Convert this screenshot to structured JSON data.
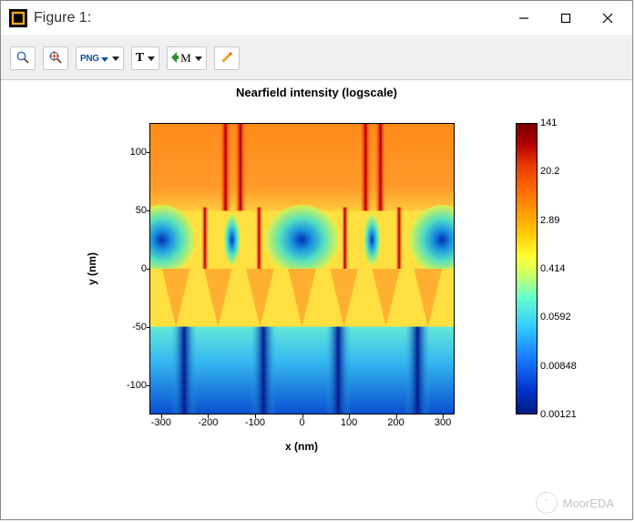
{
  "window": {
    "title": "Figure 1:"
  },
  "toolbar": {
    "png_label": "PNG",
    "t_label": "T",
    "m_label": "M"
  },
  "chart_data": {
    "type": "heatmap",
    "title": "Nearfield intensity (logscale)",
    "xlabel": "x (nm)",
    "ylabel": "y (nm)",
    "x_ticks": [
      -300,
      -200,
      -100,
      0,
      100,
      200,
      300
    ],
    "y_ticks": [
      -100,
      -50,
      0,
      50,
      100
    ],
    "xlim": [
      -325,
      325
    ],
    "ylim": [
      -125,
      125
    ],
    "colorbar_scale": "log",
    "colorbar_ticks": [
      141,
      20.2,
      2.89,
      0.414,
      0.0592,
      0.00848,
      0.00121
    ],
    "regions": [
      {
        "y_range": "50 to 125",
        "description": "Upper band dominated by warm colors (orange/red); two pairs of narrow vertical red peaks reach toward top at roughly x ≈ -150 and x ≈ +150."
      },
      {
        "y_range": "0 to 50",
        "description": "Row of rounded cyan/green low-intensity lobes (≈0.06–0.4) centered near y≈25 at x ≈ -300, -150, 0, +150, +300, separated by thin red high-intensity ridges; dark-blue minima at lobe centers."
      },
      {
        "y_range": "-50 to 0",
        "description": "Mostly yellow (~2.9) with downward-pointing yellow/orange zigzag fringes."
      },
      {
        "y_range": "-125 to -50",
        "description": "Broad cyan/blue low-intensity region; four darker blue vertical streaks near x ≈ -250, -80, +80, +250 reaching the bottom (≈0.001–0.06)."
      }
    ]
  },
  "watermark": {
    "text": "MoorEDA"
  }
}
